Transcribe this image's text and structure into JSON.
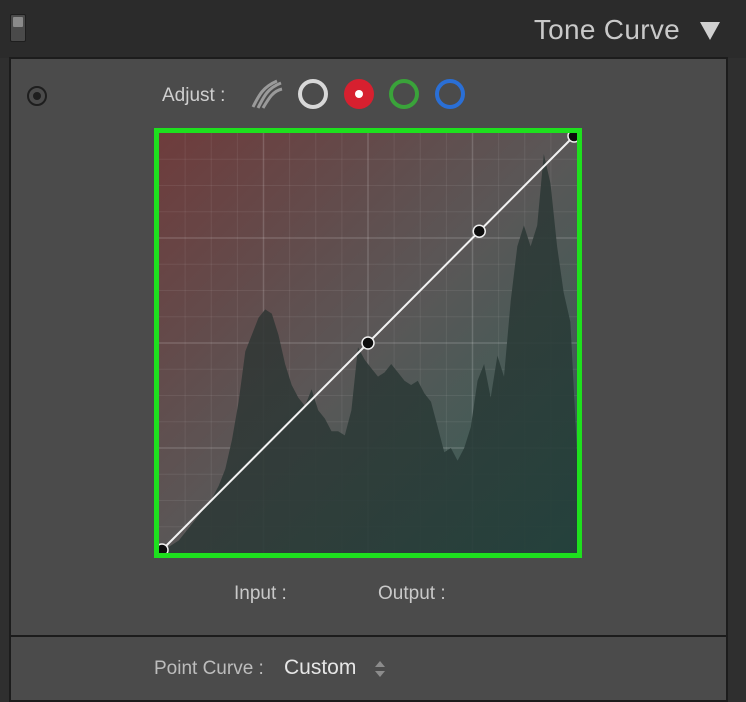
{
  "header": {
    "title": "Tone Curve",
    "collapse_icon": "square-toggle-icon",
    "expand_icon": "triangle-down-icon"
  },
  "toolbar": {
    "adjust_label": "Adjust :",
    "target_icon": "target-adjust-icon",
    "channels": [
      {
        "name": "parametric",
        "icon": "parametric-curve-icon",
        "color": "#9a9a9a"
      },
      {
        "name": "rgb",
        "icon": "circle-white-icon",
        "color": "#d8d8d8"
      },
      {
        "name": "red",
        "icon": "circle-red-icon",
        "color": "#d7202f",
        "selected": true
      },
      {
        "name": "green",
        "icon": "circle-green-icon",
        "color": "#3aa33a"
      },
      {
        "name": "blue",
        "icon": "circle-blue-icon",
        "color": "#2a6fd6"
      }
    ]
  },
  "curve": {
    "channel": "red",
    "border_color": "#1ee01e",
    "points": [
      {
        "input": 0,
        "output": 0
      },
      {
        "input": 0.5,
        "output": 0.5
      },
      {
        "input": 0.77,
        "output": 0.77
      },
      {
        "input": 1,
        "output": 1
      }
    ],
    "histogram": [
      0.01,
      0.01,
      0.02,
      0.03,
      0.05,
      0.07,
      0.09,
      0.11,
      0.13,
      0.16,
      0.2,
      0.27,
      0.36,
      0.48,
      0.52,
      0.56,
      0.58,
      0.57,
      0.52,
      0.45,
      0.4,
      0.37,
      0.35,
      0.39,
      0.34,
      0.32,
      0.29,
      0.29,
      0.28,
      0.34,
      0.49,
      0.46,
      0.44,
      0.42,
      0.43,
      0.45,
      0.43,
      0.41,
      0.4,
      0.41,
      0.38,
      0.36,
      0.3,
      0.24,
      0.25,
      0.22,
      0.25,
      0.3,
      0.41,
      0.45,
      0.37,
      0.47,
      0.42,
      0.6,
      0.73,
      0.78,
      0.73,
      0.78,
      0.95,
      0.88,
      0.73,
      0.62,
      0.55,
      0.24
    ]
  },
  "io": {
    "input_label": "Input :",
    "output_label": "Output :"
  },
  "point_curve": {
    "label": "Point Curve :",
    "value": "Custom",
    "stepper_icon": "up-down-stepper-icon"
  }
}
